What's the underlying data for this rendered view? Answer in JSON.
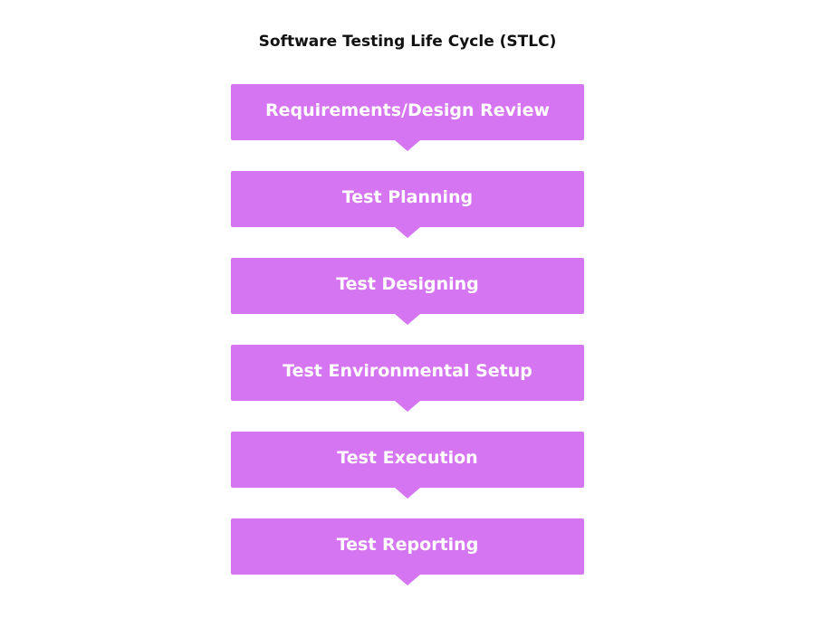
{
  "title": "Software Testing Life Cycle (STLC)",
  "colors": {
    "step_fill": "#d575f1",
    "step_text": "#ffffff",
    "title_text": "#111111"
  },
  "steps": [
    {
      "label": "Requirements/Design Review"
    },
    {
      "label": "Test Planning"
    },
    {
      "label": "Test Designing"
    },
    {
      "label": "Test Environmental Setup"
    },
    {
      "label": "Test Execution"
    },
    {
      "label": "Test Reporting"
    }
  ]
}
